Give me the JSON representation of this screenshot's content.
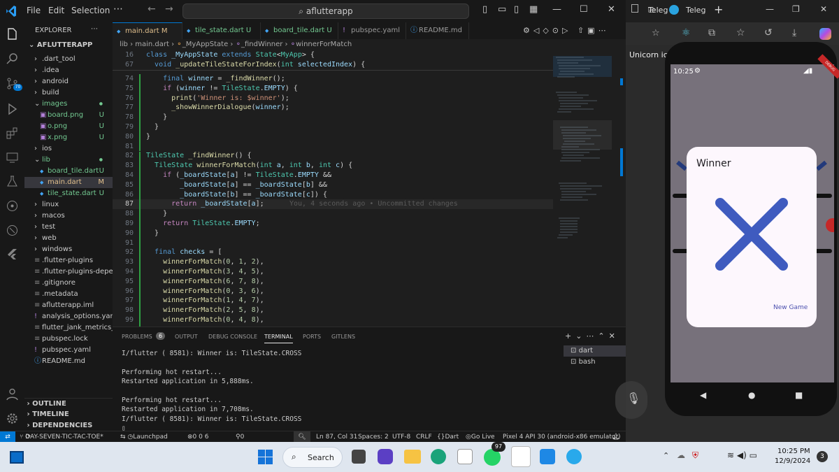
{
  "titlebar": {
    "menu": [
      "File",
      "Edit",
      "Selection"
    ],
    "search": "aflutterapp"
  },
  "explorer": {
    "title": "EXPLORER",
    "project": "AFLUTTERAPP",
    "items": [
      {
        "label": ".dart_tool",
        "badge": ""
      },
      {
        "label": ".idea",
        "badge": ""
      },
      {
        "label": "android",
        "badge": ""
      },
      {
        "label": "build",
        "badge": ""
      },
      {
        "label": "images",
        "badge": ""
      },
      {
        "label": "board.png",
        "badge": "U"
      },
      {
        "label": "o.png",
        "badge": "U"
      },
      {
        "label": "x.png",
        "badge": "U"
      },
      {
        "label": "ios",
        "badge": ""
      },
      {
        "label": "lib",
        "badge": ""
      },
      {
        "label": "board_tile.dart",
        "badge": "U"
      },
      {
        "label": "main.dart",
        "badge": "M"
      },
      {
        "label": "tile_state.dart",
        "badge": "U"
      },
      {
        "label": "linux",
        "badge": ""
      },
      {
        "label": "macos",
        "badge": ""
      },
      {
        "label": "test",
        "badge": ""
      },
      {
        "label": "web",
        "badge": ""
      },
      {
        "label": "windows",
        "badge": ""
      },
      {
        "label": ".flutter-plugins",
        "badge": ""
      },
      {
        "label": ".flutter-plugins-depe...",
        "badge": ""
      },
      {
        "label": ".gitignore",
        "badge": ""
      },
      {
        "label": ".metadata",
        "badge": ""
      },
      {
        "label": "aflutterapp.iml",
        "badge": ""
      },
      {
        "label": "analysis_options.yaml",
        "badge": ""
      },
      {
        "label": "flutter_jank_metrics_0...",
        "badge": ""
      },
      {
        "label": "pubspec.lock",
        "badge": ""
      },
      {
        "label": "pubspec.yaml",
        "badge": ""
      },
      {
        "label": "README.md",
        "badge": ""
      }
    ],
    "sections": [
      "OUTLINE",
      "TIMELINE",
      "DEPENDENCIES"
    ]
  },
  "tabs": [
    {
      "label": "main.dart",
      "badge": "M"
    },
    {
      "label": "tile_state.dart",
      "badge": "U"
    },
    {
      "label": "board_tile.dart",
      "badge": "U"
    },
    {
      "label": "pubspec.yaml",
      "badge": ""
    },
    {
      "label": "README.md",
      "badge": ""
    }
  ],
  "breadcrumb": {
    "a": "lib",
    "b": "main.dart",
    "c": "_MyAppState",
    "d": "_findWinner",
    "e": "winnerForMatch"
  },
  "code": {
    "sticky": [
      {
        "n": "16",
        "t": "class _MyAppState extends State<MyApp> {"
      },
      {
        "n": "67",
        "t": "  void _updateTileStateForIndex(int selectedIndex) {"
      }
    ],
    "lines": [
      {
        "n": "74",
        "t": "    final winner = _findWinner();"
      },
      {
        "n": "75",
        "t": "    if (winner != TileState.EMPTY) {"
      },
      {
        "n": "76",
        "t": "      print('Winner is: $winner');"
      },
      {
        "n": "77",
        "t": "      _showWinnerDialogue(winner);"
      },
      {
        "n": "78",
        "t": "    }"
      },
      {
        "n": "79",
        "t": "  }"
      },
      {
        "n": "80",
        "t": "}"
      },
      {
        "n": "81",
        "t": ""
      },
      {
        "n": "82",
        "t": "TileState _findWinner() {"
      },
      {
        "n": "83",
        "t": "  TileState winnerForMatch(int a, int b, int c) {"
      },
      {
        "n": "84",
        "t": "    if (_boardState[a] != TileState.EMPTY &&"
      },
      {
        "n": "85",
        "t": "        _boardState[a] == _boardState[b] &&"
      },
      {
        "n": "86",
        "t": "        _boardState[b] == _boardState[c]) {"
      },
      {
        "n": "87",
        "t": "      return _boardState[a];"
      },
      {
        "n": "88",
        "t": "    }"
      },
      {
        "n": "89",
        "t": "    return TileState.EMPTY;"
      },
      {
        "n": "90",
        "t": "  }"
      },
      {
        "n": "91",
        "t": ""
      },
      {
        "n": "92",
        "t": "  final checks = ["
      },
      {
        "n": "93",
        "t": "    winnerForMatch(0, 1, 2),"
      },
      {
        "n": "94",
        "t": "    winnerForMatch(3, 4, 5),"
      },
      {
        "n": "95",
        "t": "    winnerForMatch(6, 7, 8),"
      },
      {
        "n": "96",
        "t": "    winnerForMatch(0, 3, 6),"
      },
      {
        "n": "97",
        "t": "    winnerForMatch(1, 4, 7),"
      },
      {
        "n": "98",
        "t": "    winnerForMatch(2, 5, 8),"
      },
      {
        "n": "99",
        "t": "    winnerForMatch(0, 4, 8),"
      }
    ],
    "blame": "You, 4 seconds ago • Uncommitted changes"
  },
  "panel": {
    "tabs": [
      "PROBLEMS",
      "OUTPUT",
      "DEBUG CONSOLE",
      "TERMINAL",
      "PORTS",
      "GITLENS"
    ],
    "problems_count": "6",
    "terminal": [
      "I/flutter ( 8581): Winner is: TileState.CROSS",
      "",
      "Performing hot restart...",
      "Restarted application in 5,888ms.",
      "",
      "Performing hot restart...",
      "Restarted application in 7,708ms.",
      "I/flutter ( 8581): Winner is: TileState.CROSS"
    ],
    "terminals": [
      "dart",
      "bash"
    ]
  },
  "statusbar": {
    "branch": "DAY-SEVEN-TIC-TAC-TOE*",
    "launchpad": "Launchpad",
    "counts": "0 0 6",
    "ports": "0",
    "position": "Ln 87, Col 31",
    "spaces": "Spaces: 2",
    "encoding": "UTF-8",
    "eol": "CRLF",
    "lang": "Dart",
    "golive": "Go Live",
    "device": "Pixel 4 API 30 (android-x86 emulator)"
  },
  "browser": {
    "tab1": "Teleg",
    "tab2": "Teleg",
    "sidetext": "Unicorn ico"
  },
  "phone": {
    "time": "10:25",
    "dialog_title": "Winner",
    "button": "New Game"
  },
  "taskbar": {
    "search": "Search",
    "whatsapp_badge": "97",
    "time": "10:25 PM",
    "date": "12/9/2024",
    "notif": "3"
  },
  "colors": {
    "accent": "#0078d4",
    "x_mark": "#3f5bbf",
    "statusbar": "#181818"
  }
}
